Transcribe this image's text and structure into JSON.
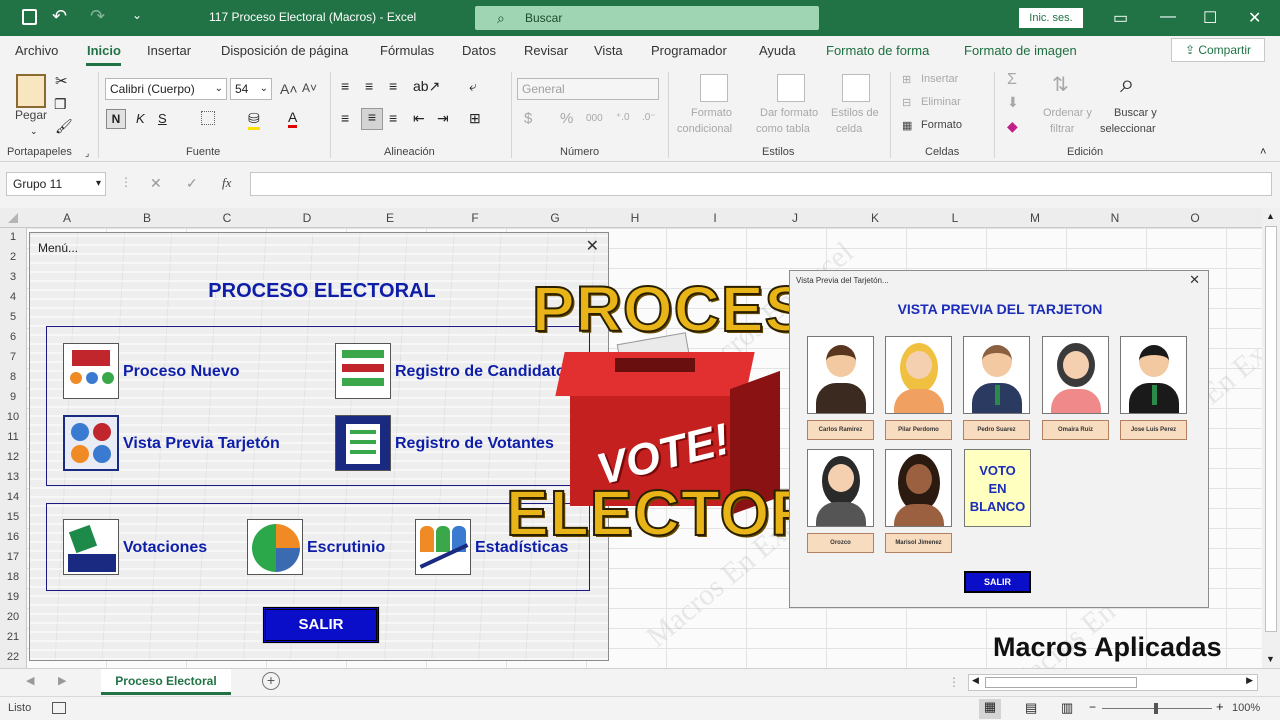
{
  "window": {
    "title": "117 Proceso Electoral (Macros)  -  Excel",
    "search": "Buscar",
    "signin": "Inic. ses."
  },
  "ribbon_tabs": [
    "Archivo",
    "Inicio",
    "Insertar",
    "Disposición de página",
    "Fórmulas",
    "Datos",
    "Revisar",
    "Vista",
    "Programador",
    "Ayuda",
    "Formato de forma",
    "Formato de imagen"
  ],
  "share": "Compartir",
  "ribbon": {
    "pegar": "Pegar",
    "font_name": "Calibri (Cuerpo)",
    "font_size": "54",
    "bold": "N",
    "italic": "K",
    "underline": "S",
    "number_format": "General",
    "formato_condicional": [
      "Formato",
      "condicional"
    ],
    "dar_formato": [
      "Dar formato",
      "como tabla"
    ],
    "estilos_celda": [
      "Estilos de",
      "celda"
    ],
    "insertar": "Insertar",
    "eliminar": "Eliminar",
    "formato": "Formato",
    "ordenar": [
      "Ordenar y",
      "filtrar"
    ],
    "buscar": [
      "Buscar y",
      "seleccionar"
    ],
    "groups": [
      "Portapapeles",
      "Fuente",
      "Alineación",
      "Número",
      "Estilos",
      "Celdas",
      "Edición"
    ]
  },
  "name_box": "Grupo 11",
  "columns": [
    "A",
    "B",
    "C",
    "D",
    "E",
    "F",
    "G",
    "H",
    "I",
    "J",
    "K",
    "L",
    "M",
    "N",
    "O"
  ],
  "rows": [
    "1",
    "2",
    "3",
    "4",
    "5",
    "6",
    "7",
    "8",
    "9",
    "10",
    "11",
    "12",
    "13",
    "14",
    "15",
    "16",
    "17",
    "18",
    "19",
    "20",
    "21",
    "22"
  ],
  "watermark": "Macros En Excel",
  "menu": {
    "title": "Menú...",
    "heading": "PROCESO ELECTORAL",
    "items": [
      "Proceso Nuevo",
      "Registro de Candidatos",
      "Vista Previa Tarjetón",
      "Registro de Votantes",
      "Votaciones",
      "Escrutinio",
      "Estadísticas"
    ],
    "salir": "SALIR"
  },
  "overlay": {
    "line1": "PROCESO",
    "line2": "ELECTORAL",
    "box_text": "VOTE!"
  },
  "preview": {
    "title": "Vista Previa del Tarjetón...",
    "heading": "VISTA PREVIA DEL TARJETON",
    "candidates": [
      "Carlos Ramirez",
      "Pilar Perdomo",
      "Pedro Suarez",
      "Omaira Ruiz",
      "Jose Luis Perez",
      "Orozco",
      "Marisol Jimenez"
    ],
    "blank": [
      "VOTO",
      "EN",
      "BLANCO"
    ],
    "salir": "SALIR"
  },
  "brand": "Macros Aplicadas",
  "sheet_tab": "Proceso Electoral",
  "status": {
    "ready": "Listo",
    "zoom": "100%"
  },
  "colors": {
    "excel_green": "#217346",
    "menu_blue": "#0e1ea8",
    "button_blue": "#0b0ec9",
    "gold": "#e8b418",
    "ballot_red": "#d42b2b"
  }
}
